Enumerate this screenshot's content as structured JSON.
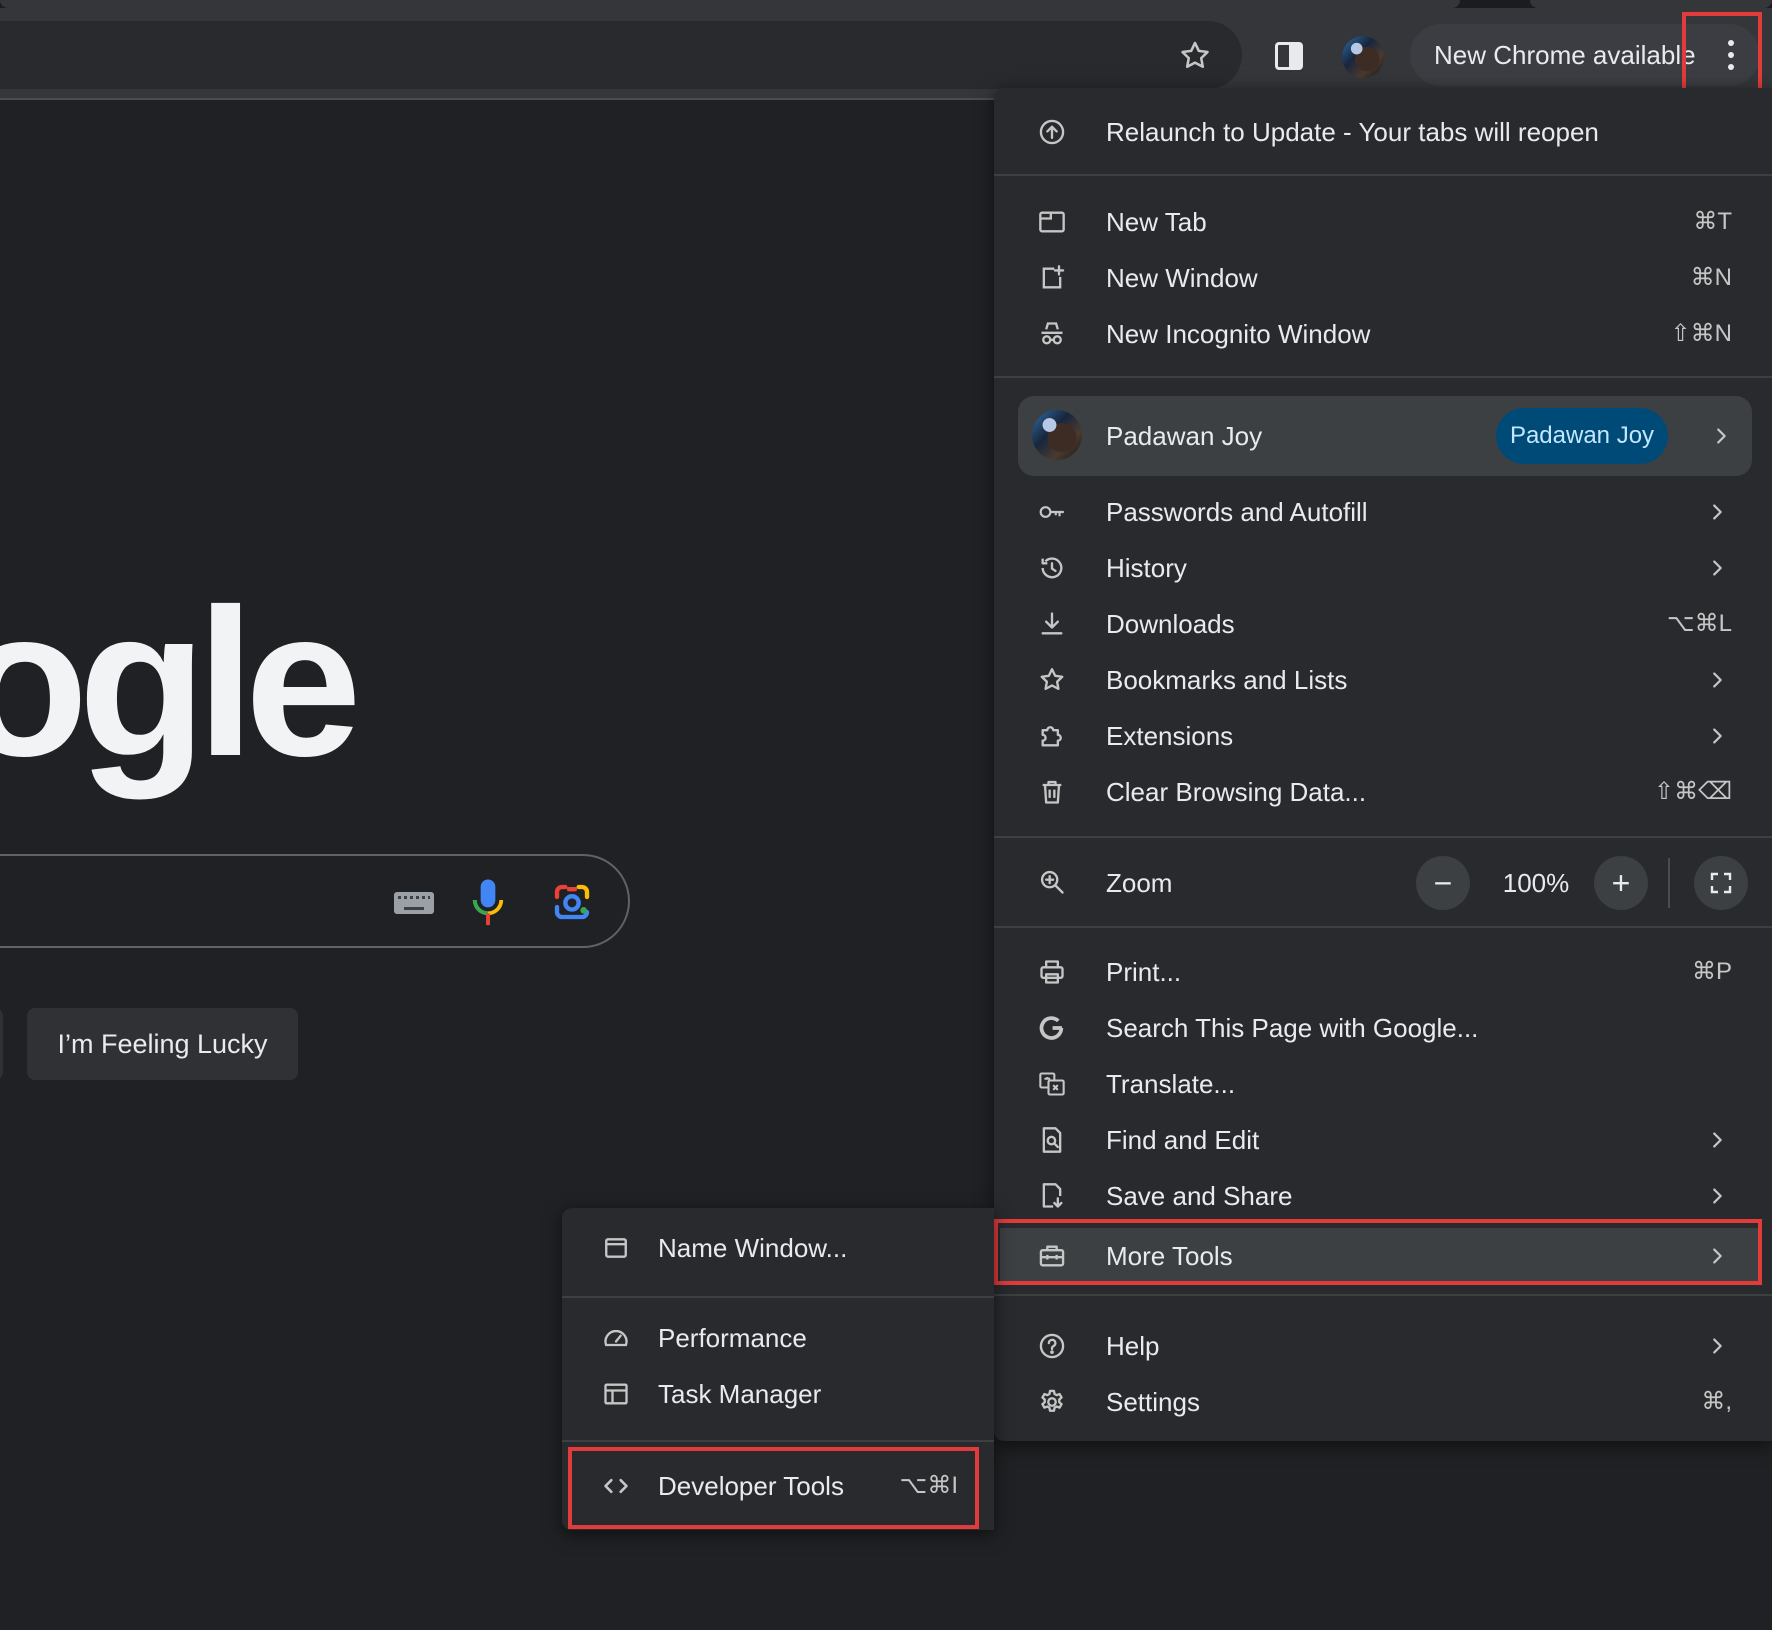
{
  "toolbar": {
    "update_chip_label": "New Chrome available"
  },
  "google": {
    "logo_text": "ogle",
    "feeling_lucky_label": "I’m Feeling Lucky"
  },
  "main_menu": {
    "relaunch_label": "Relaunch to Update - Your tabs will reopen",
    "new_tab": {
      "label": "New Tab",
      "shortcut": "⌘T"
    },
    "new_window": {
      "label": "New Window",
      "shortcut": "⌘N"
    },
    "new_incognito": {
      "label": "New Incognito Window",
      "shortcut": "⇧⌘N"
    },
    "profile": {
      "name": "Padawan Joy",
      "chip": "Padawan Joy"
    },
    "passwords": {
      "label": "Passwords and Autofill"
    },
    "history": {
      "label": "History"
    },
    "downloads": {
      "label": "Downloads",
      "shortcut": "⌥⌘L"
    },
    "bookmarks": {
      "label": "Bookmarks and Lists"
    },
    "extensions": {
      "label": "Extensions"
    },
    "clear_data": {
      "label": "Clear Browsing Data...",
      "shortcut": "⇧⌘⌫"
    },
    "zoom": {
      "label": "Zoom",
      "value": "100%",
      "minus": "−",
      "plus": "+"
    },
    "print": {
      "label": "Print...",
      "shortcut": "⌘P"
    },
    "search_page": {
      "label": "Search This Page with Google..."
    },
    "translate": {
      "label": "Translate..."
    },
    "find_edit": {
      "label": "Find and Edit"
    },
    "save_share": {
      "label": "Save and Share"
    },
    "more_tools": {
      "label": "More Tools"
    },
    "help": {
      "label": "Help"
    },
    "settings": {
      "label": "Settings",
      "shortcut": "⌘,"
    }
  },
  "sub_menu": {
    "name_window": {
      "label": "Name Window..."
    },
    "performance": {
      "label": "Performance"
    },
    "task_manager": {
      "label": "Task Manager"
    },
    "developer_tools": {
      "label": "Developer Tools",
      "shortcut": "⌥⌘I"
    }
  },
  "colors": {
    "page_bg": "#202124",
    "menu_bg": "#282a2d",
    "highlight": "#e23b3b",
    "profile_chip_bg": "#004a77"
  },
  "icons": [
    "star-icon",
    "side-panel-icon",
    "more-vert-icon",
    "update-icon",
    "new-tab-icon",
    "new-window-icon",
    "incognito-icon",
    "key-icon",
    "history-icon",
    "download-icon",
    "bookmark-star-icon",
    "extension-puzzle-icon",
    "trash-icon",
    "zoom-icon",
    "fullscreen-icon",
    "print-icon",
    "google-g-icon",
    "translate-icon",
    "find-page-icon",
    "save-share-icon",
    "toolbox-icon",
    "help-icon",
    "settings-gear-icon",
    "window-icon",
    "performance-gauge-icon",
    "task-manager-icon",
    "code-brackets-icon",
    "chevron-right-icon",
    "keyboard-icon",
    "mic-icon",
    "lens-camera-icon"
  ]
}
